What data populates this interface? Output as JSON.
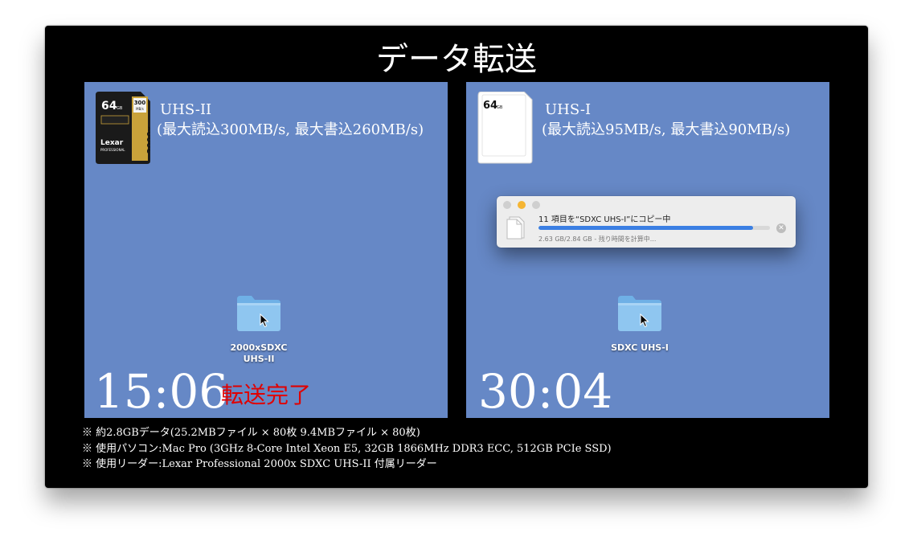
{
  "slide": {
    "title": "データ転送"
  },
  "left": {
    "card": {
      "capacity": "64",
      "unit": "GB",
      "speed": "300",
      "speed_unit": "MB/s",
      "brand": "Lexar",
      "line": "PROFESSIONAL",
      "rating": "2000x"
    },
    "spec_line1": "UHS-II",
    "spec_line2": "(最大読込300MB/s, 最大書込260MB/s)",
    "folder_label_1": "2000xSDXC",
    "folder_label_2": "UHS-II",
    "timer": "15:06",
    "status": "転送完了"
  },
  "right": {
    "card": {
      "capacity": "64",
      "unit": "GB"
    },
    "spec_line1": "UHS-I",
    "spec_line2": "(最大読込95MB/s, 最大書込90MB/s)",
    "folder_label": "SDXC UHS-I",
    "timer": "30:04",
    "dialog": {
      "title": "11 項目を“SDXC UHS-I”にコピー中",
      "status": "2.63 GB/2.84 GB - 残り時間を計算中...",
      "progress": 0.926
    }
  },
  "notes": [
    "※ 約2.8GBデータ(25.2MBファイル × 80枚  9.4MBファイル × 80枚)",
    "※ 使用パソコン:Mac Pro (3GHz 8-Core Intel Xeon E5, 32GB 1866MHz DDR3 ECC, 512GB PCIe SSD)",
    "※ 使用リーダー:Lexar Professional 2000x SDXC UHS-II 付属リーダー"
  ],
  "colors": {
    "panel": "#6688c6",
    "accent_red": "#e00000",
    "progress_blue": "#3b7fe3",
    "folder_blue": "#8fc6f0"
  }
}
